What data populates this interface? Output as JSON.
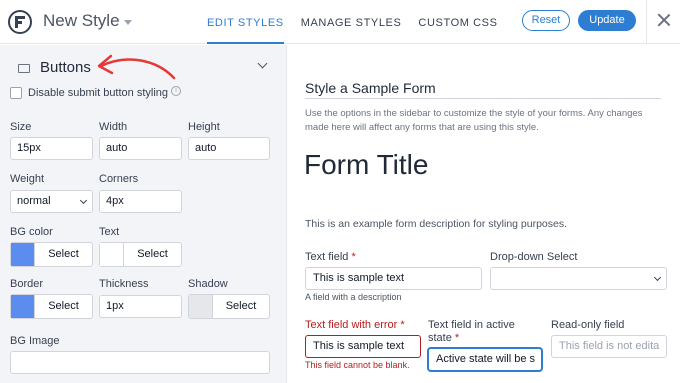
{
  "header": {
    "app_title": "New Style",
    "tabs": [
      {
        "label": "EDIT STYLES",
        "active": true
      },
      {
        "label": "MANAGE STYLES",
        "active": false
      },
      {
        "label": "CUSTOM CSS",
        "active": false
      }
    ],
    "reset_label": "Reset",
    "update_label": "Update",
    "accent_color": "#2d7dd2"
  },
  "sidebar": {
    "section_title": "Buttons",
    "disable_submit_label": "Disable submit button styling",
    "size": {
      "label": "Size",
      "value": "15px"
    },
    "width": {
      "label": "Width",
      "value": "auto"
    },
    "height": {
      "label": "Height",
      "value": "auto"
    },
    "weight": {
      "label": "Weight",
      "value": "normal"
    },
    "corners": {
      "label": "Corners",
      "value": "4px"
    },
    "bg_color": {
      "label": "BG color",
      "button": "Select",
      "swatch": "#5b8def"
    },
    "text": {
      "label": "Text",
      "button": "Select",
      "swatch": "#ffffff"
    },
    "border": {
      "label": "Border",
      "button": "Select",
      "swatch": "#5b8def"
    },
    "thickness": {
      "label": "Thickness",
      "value": "1px"
    },
    "shadow": {
      "label": "Shadow",
      "button": "Select",
      "swatch": "#e5e7eb"
    },
    "bg_image": {
      "label": "BG Image",
      "value": ""
    }
  },
  "preview": {
    "heading": "Style a Sample Form",
    "description": "Use the options in the sidebar to customize the style of your forms. Any changes made here will affect any forms that are using this style.",
    "form_title": "Form Title",
    "form_description": "This is an example form description for styling purposes.",
    "text_field": {
      "label": "Text field",
      "required": "*",
      "value": "This is sample text",
      "help": "A field with a description"
    },
    "dropdown": {
      "label": "Drop-down Select",
      "value": ""
    },
    "error_field": {
      "label": "Text field with error",
      "required": "*",
      "value": "This is sample text",
      "help": "This field cannot be blank."
    },
    "active_field": {
      "label": "Text field in active state",
      "required": "*",
      "value": "Active state will be s"
    },
    "readonly_field": {
      "label": "Read-only field",
      "value": "This field is not edita"
    }
  }
}
